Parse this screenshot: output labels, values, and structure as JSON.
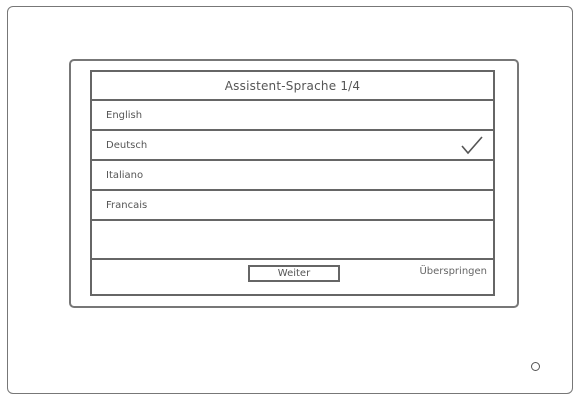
{
  "wizard": {
    "title": "Assistent-Sprache 1/4",
    "languages": [
      {
        "label": "English",
        "selected": false
      },
      {
        "label": "Deutsch",
        "selected": true
      },
      {
        "label": "Italiano",
        "selected": false
      },
      {
        "label": "Francais",
        "selected": false
      }
    ],
    "next_label": "Weiter",
    "skip_label": "Überspringen"
  },
  "icons": {
    "selected": "checkmark-icon",
    "status": "led-indicator-icon"
  },
  "colors": {
    "frame": "#777777",
    "text": "#555555",
    "background": "#ffffff"
  }
}
